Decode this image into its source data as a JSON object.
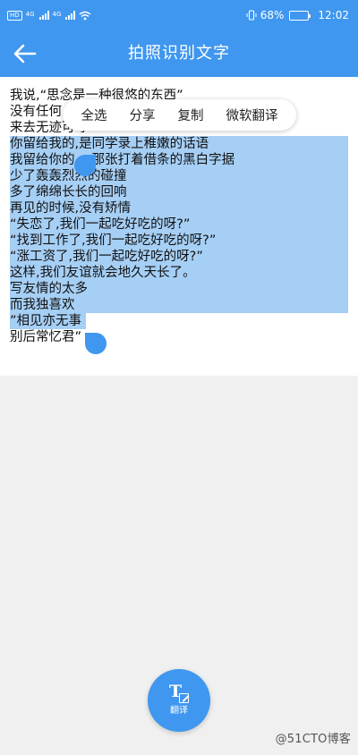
{
  "status_bar": {
    "hd_badge": "HD",
    "net1": "4G",
    "net2": "4G",
    "battery_text": "68%",
    "battery_level": 0.68,
    "time": "12:02"
  },
  "header": {
    "title": "拍照识别文字",
    "back_icon": "arrow-left-icon"
  },
  "context_menu": {
    "items": [
      "全选",
      "分享",
      "复制",
      "微软翻译"
    ]
  },
  "lines": [
    "我说,“思念是一种很悠的东西”",
    "没有任何",
    "来去无迹可寻",
    "你留给我的,是同学录上稚嫩的话语",
    "我留给你的,一那张打着借条的黑白字据",
    "少了轰轰烈烈的碰撞",
    "多了绵绵长长的回响",
    "再见的时候,没有矫情",
    "“失恋了,我们一起吃好吃的呀?”",
    "“找到工作了,我们一起吃好吃的呀?”",
    "“涨工资了,我们一起吃好吃的呀?”",
    "这样,我们友谊就会地久天长了。",
    "写友情的太多",
    "而我独喜欢",
    "”相见亦无事",
    "别后常忆君”"
  ],
  "fab": {
    "icon_glyph": "T",
    "label": "翻译"
  },
  "watermark": "@51CTO博客",
  "colors": {
    "primary": "#3f97ef",
    "selection": "#a6cff5"
  }
}
